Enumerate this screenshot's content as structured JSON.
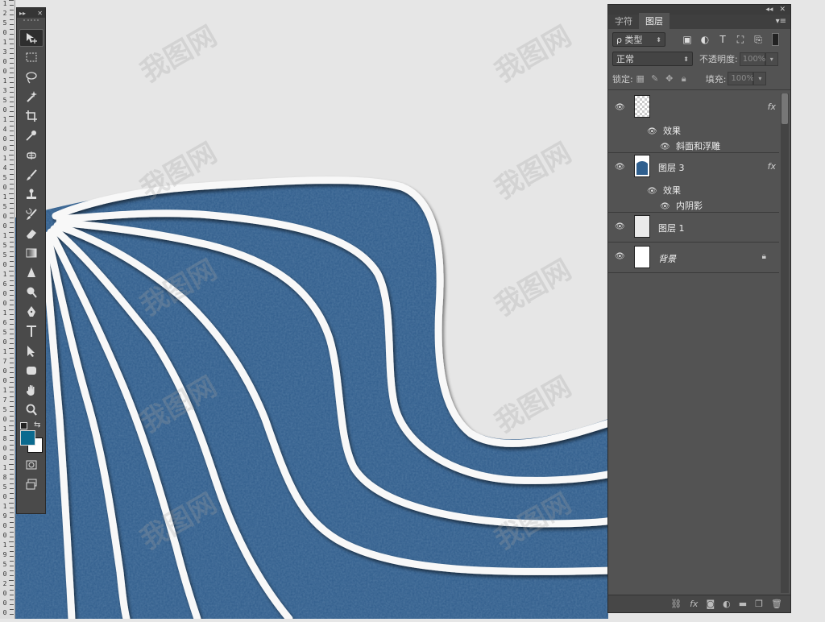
{
  "ruler": {
    "digits": [
      "1",
      "2",
      "5",
      "0",
      "1",
      "3",
      "0",
      "0",
      "1",
      "3",
      "5",
      "0",
      "1",
      "4",
      "0",
      "0",
      "1",
      "4",
      "5",
      "0",
      "1",
      "5",
      "0",
      "0",
      "1",
      "5",
      "5",
      "0",
      "1",
      "6",
      "0",
      "0",
      "1",
      "6",
      "5",
      "0",
      "1",
      "7",
      "0",
      "0",
      "1",
      "7",
      "5",
      "0",
      "1",
      "8",
      "0",
      "0",
      "1",
      "8",
      "5",
      "0",
      "1",
      "9",
      "0",
      "0",
      "1",
      "9",
      "5",
      "0",
      "2",
      "0",
      "0",
      "0"
    ]
  },
  "watermark": {
    "text": "我图网"
  },
  "toolbar": {
    "collapse_label": "▸▸",
    "close_label": "✕",
    "tools": [
      "move",
      "marquee",
      "lasso",
      "magic-wand",
      "crop",
      "eyedropper",
      "healing",
      "brush",
      "stamp",
      "history-brush",
      "eraser",
      "gradient",
      "blur",
      "dodge",
      "pen",
      "type",
      "path-select",
      "shape",
      "hand",
      "zoom"
    ],
    "foreground_color": "#0b6a8f",
    "background_color": "#ffffff"
  },
  "panel": {
    "collapse_label": "◂◂",
    "close_label": "✕",
    "tabs": [
      "字符",
      "图层"
    ],
    "active_tab": "图层",
    "filter": {
      "kind_label": "ρ 类型"
    },
    "blend_mode": "正常",
    "opacity_label": "不透明度:",
    "opacity_value": "100%",
    "lock_label": "锁定:",
    "fill_label": "填充:",
    "fill_value": "100%",
    "layers": [
      {
        "name": "",
        "fx": "fx",
        "effects_label": "效果",
        "effect": "斜面和浮雕"
      },
      {
        "name": "图层 3",
        "fx": "fx",
        "effects_label": "效果",
        "effect": "内阴影"
      },
      {
        "name": "图层 1"
      },
      {
        "name": "背景"
      }
    ]
  }
}
